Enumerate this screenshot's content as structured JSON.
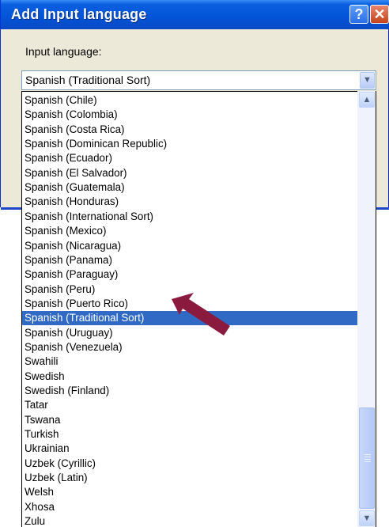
{
  "dialog": {
    "title": "Add Input language",
    "help_label": "?",
    "close_label": "✕",
    "field_label": "Input language:",
    "selected_value": "Spanish (Traditional Sort)"
  },
  "list": {
    "items": [
      "Spanish (Chile)",
      "Spanish (Colombia)",
      "Spanish (Costa Rica)",
      "Spanish (Dominican Republic)",
      "Spanish (Ecuador)",
      "Spanish (El Salvador)",
      "Spanish (Guatemala)",
      "Spanish (Honduras)",
      "Spanish (International Sort)",
      "Spanish (Mexico)",
      "Spanish (Nicaragua)",
      "Spanish (Panama)",
      "Spanish (Paraguay)",
      "Spanish (Peru)",
      "Spanish (Puerto Rico)",
      "Spanish (Traditional Sort)",
      "Spanish (Uruguay)",
      "Spanish (Venezuela)",
      "Swahili",
      "Swedish",
      "Swedish (Finland)",
      "Tatar",
      "Tswana",
      "Turkish",
      "Ukrainian",
      "Uzbek (Cyrillic)",
      "Uzbek (Latin)",
      "Welsh",
      "Xhosa",
      "Zulu"
    ],
    "selected_index": 15
  },
  "annotation": {
    "arrow_color": "#8b1a3f"
  },
  "colors": {
    "titlebar": "#0354d6",
    "selection": "#316ac5"
  }
}
